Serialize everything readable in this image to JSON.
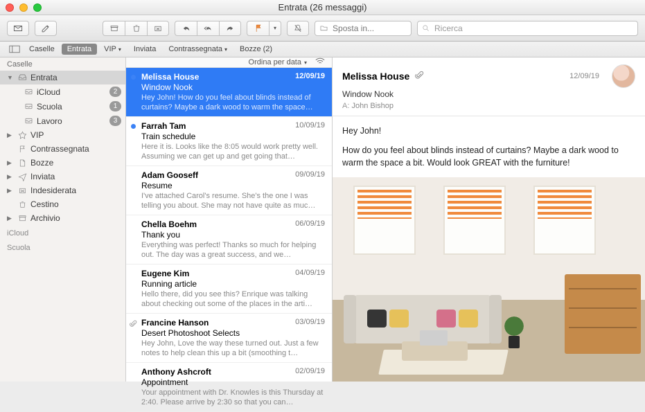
{
  "window": {
    "title": "Entrata (26 messaggi)"
  },
  "toolbar": {
    "move_placeholder": "Sposta in...",
    "search_placeholder": "Ricerca"
  },
  "favbar": {
    "mailboxes": "Caselle",
    "inbox": "Entrata",
    "vip": "VIP",
    "sent": "Inviata",
    "flagged": "Contrassegnata",
    "drafts": "Bozze (2)"
  },
  "sidebar": {
    "header": "Caselle",
    "items": [
      {
        "label": "Entrata",
        "icon": "inbox",
        "selected": true,
        "disclose": "▼"
      },
      {
        "label": "iCloud",
        "icon": "tray",
        "sub": true,
        "badge": "2"
      },
      {
        "label": "Scuola",
        "icon": "tray",
        "sub": true,
        "badge": "1"
      },
      {
        "label": "Lavoro",
        "icon": "tray",
        "sub": true,
        "badge": "3"
      },
      {
        "label": "VIP",
        "icon": "star",
        "disclose": "▶"
      },
      {
        "label": "Contrassegnata",
        "icon": "flag"
      },
      {
        "label": "Bozze",
        "icon": "doc",
        "disclose": "▶"
      },
      {
        "label": "Inviata",
        "icon": "plane",
        "disclose": "▶"
      },
      {
        "label": "Indesiderata",
        "icon": "junk",
        "disclose": "▶"
      },
      {
        "label": "Cestino",
        "icon": "trash"
      },
      {
        "label": "Archivio",
        "icon": "archive",
        "disclose": "▶"
      }
    ],
    "sections": [
      "iCloud",
      "Scuola"
    ]
  },
  "sort": {
    "label": "Ordina per data"
  },
  "messages": [
    {
      "from": "Melissa House",
      "date": "12/09/19",
      "subject": "Window Nook",
      "preview": "Hey John! How do you feel about blinds instead of curtains? Maybe a dark wood to warm the space…",
      "unread": true,
      "selected": true
    },
    {
      "from": "Farrah Tam",
      "date": "10/09/19",
      "subject": "Train schedule",
      "preview": "Here it is. Looks like the 8:05 would work pretty well. Assuming we can get up and get going that…",
      "unread": true
    },
    {
      "from": "Adam Gooseff",
      "date": "09/09/19",
      "subject": "Resume",
      "preview": "I've attached Carol's resume. She's the one I was telling you about. She may not have quite as muc…"
    },
    {
      "from": "Chella Boehm",
      "date": "06/09/19",
      "subject": "Thank you",
      "preview": "Everything was perfect! Thanks so much for helping out. The day was a great success, and we…"
    },
    {
      "from": "Eugene Kim",
      "date": "04/09/19",
      "subject": "Running article",
      "preview": "Hello there, did you see this? Enrique was talking about checking out some of the places in the arti…"
    },
    {
      "from": "Francine Hanson",
      "date": "03/09/19",
      "subject": "Desert Photoshoot Selects",
      "preview": "Hey John, Love the way these turned out. Just a few notes to help clean this up a bit (smoothing t…",
      "attachment": true
    },
    {
      "from": "Anthony Ashcroft",
      "date": "02/09/19",
      "subject": "Appointment",
      "preview": "Your appointment with Dr. Knowles is this Thursday at 2:40. Please arrive by 2:30 so that you can…"
    }
  ],
  "reader": {
    "from": "Melissa House",
    "date": "12/09/19",
    "subject": "Window Nook",
    "to_label": "A:",
    "to": "John Bishop",
    "body_greeting": "Hey John!",
    "body_text": "How do you feel about blinds instead of curtains? Maybe a dark wood to warm the space a bit. Would look GREAT with the furniture!"
  }
}
